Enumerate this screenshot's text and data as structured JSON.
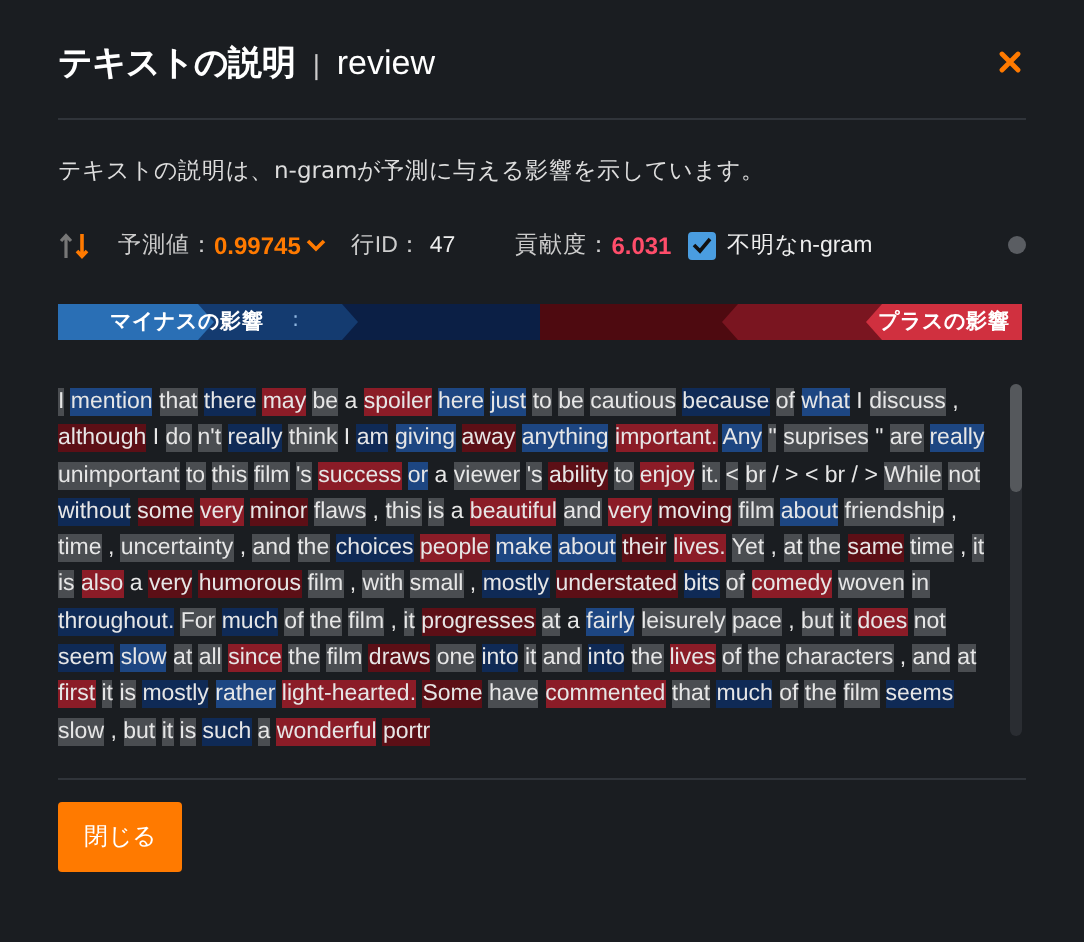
{
  "dialog": {
    "title": "テキストの説明",
    "separator": "|",
    "subtitle": "review",
    "description": "テキストの説明は、n-gramが予測に与える影響を示しています。"
  },
  "stats": {
    "prediction_label": "予測値：",
    "prediction_value": "0.99745",
    "row_label": "行ID：",
    "row_value": "47",
    "contribution_label": "貢献度：",
    "contribution_value": "6.031",
    "unknown_ngram": {
      "label": "不明なn-gram",
      "checked": true
    }
  },
  "legend": {
    "negative_label": "マイナスの影響",
    "separator": ":",
    "positive_label": "プラスの影響"
  },
  "tokens": [
    {
      "text": "I",
      "color": "#4a4d51"
    },
    {
      "text": "mention",
      "color": "#1d4682"
    },
    {
      "text": "that",
      "color": "#4a4d51"
    },
    {
      "text": "there",
      "color": "#0f2a56"
    },
    {
      "text": "may",
      "color": "#8b1c27"
    },
    {
      "text": "be",
      "color": "#4a4d51"
    },
    {
      "text": "a"
    },
    {
      "text": "spoiler",
      "color": "#8b1c27"
    },
    {
      "text": "here",
      "color": "#1d4682"
    },
    {
      "text": "just",
      "color": "#1d4682"
    },
    {
      "text": "to",
      "color": "#4a4d51"
    },
    {
      "text": "be",
      "color": "#4a4d51"
    },
    {
      "text": "cautious",
      "color": "#4a4d51"
    },
    {
      "text": "because",
      "color": "#0f2a56"
    },
    {
      "text": "of",
      "color": "#4a4d51"
    },
    {
      "text": "what",
      "color": "#1d4682"
    },
    {
      "text": "I"
    },
    {
      "text": "discuss",
      "color": "#4a4d51"
    },
    {
      "text": ","
    },
    {
      "text": "although",
      "color": "#5c0f16"
    },
    {
      "text": "I"
    },
    {
      "text": "do",
      "color": "#4a4d51"
    },
    {
      "text": "n't",
      "color": "#4a4d51"
    },
    {
      "text": "really",
      "color": "#0f2a56"
    },
    {
      "text": "think",
      "color": "#4a4d51"
    },
    {
      "text": "I"
    },
    {
      "text": "am",
      "color": "#0f2a56"
    },
    {
      "text": "giving",
      "color": "#1d4682"
    },
    {
      "text": "away",
      "color": "#5c0f16"
    },
    {
      "text": "anything",
      "color": "#1d4682"
    },
    {
      "text": "important.",
      "color": "#8b1c27"
    },
    {
      "text": "Any",
      "color": "#1d4682"
    },
    {
      "text": "\"",
      "color": "#4a4d51"
    },
    {
      "text": "suprises",
      "color": "#4a4d51"
    },
    {
      "text": "\""
    },
    {
      "text": "are",
      "color": "#4a4d51"
    },
    {
      "text": "really",
      "color": "#1d4682"
    },
    {
      "text": "unimportant",
      "color": "#4a4d51"
    },
    {
      "text": "to",
      "color": "#4a4d51"
    },
    {
      "text": "this",
      "color": "#4a4d51"
    },
    {
      "text": "film",
      "color": "#4a4d51"
    },
    {
      "text": "'s",
      "color": "#4a4d51"
    },
    {
      "text": "success",
      "color": "#8b1c27"
    },
    {
      "text": "or",
      "color": "#1d4682"
    },
    {
      "text": "a"
    },
    {
      "text": "viewer",
      "color": "#4a4d51"
    },
    {
      "text": "'s",
      "color": "#4a4d51"
    },
    {
      "text": "ability",
      "color": "#5c0f16"
    },
    {
      "text": "to",
      "color": "#4a4d51"
    },
    {
      "text": "enjoy",
      "color": "#8b1c27"
    },
    {
      "text": "it.",
      "color": "#4a4d51"
    },
    {
      "text": "<",
      "color": "#4a4d51"
    },
    {
      "text": "br",
      "color": "#4a4d51"
    },
    {
      "text": "/"
    },
    {
      "text": ">"
    },
    {
      "text": "<"
    },
    {
      "text": "br"
    },
    {
      "text": "/"
    },
    {
      "text": ">"
    },
    {
      "text": "While",
      "color": "#4a4d51"
    },
    {
      "text": "not",
      "color": "#4a4d51"
    },
    {
      "text": "without",
      "color": "#0f2a56"
    },
    {
      "text": "some",
      "color": "#5c0f16"
    },
    {
      "text": "very",
      "color": "#8b1c27"
    },
    {
      "text": "minor",
      "color": "#5c0f16"
    },
    {
      "text": "flaws",
      "color": "#4a4d51"
    },
    {
      "text": ","
    },
    {
      "text": "this",
      "color": "#4a4d51"
    },
    {
      "text": "is",
      "color": "#4a4d51"
    },
    {
      "text": "a"
    },
    {
      "text": "beautiful",
      "color": "#8b1c27"
    },
    {
      "text": "and",
      "color": "#4a4d51"
    },
    {
      "text": "very",
      "color": "#8b1c27"
    },
    {
      "text": "moving",
      "color": "#5c0f16"
    },
    {
      "text": "film",
      "color": "#4a4d51"
    },
    {
      "text": "about",
      "color": "#1d4682"
    },
    {
      "text": "friendship",
      "color": "#4a4d51"
    },
    {
      "text": ","
    },
    {
      "text": "time",
      "color": "#4a4d51"
    },
    {
      "text": ","
    },
    {
      "text": "uncertainty",
      "color": "#4a4d51"
    },
    {
      "text": ","
    },
    {
      "text": "and",
      "color": "#4a4d51"
    },
    {
      "text": "the",
      "color": "#4a4d51"
    },
    {
      "text": "choices",
      "color": "#0f2a56"
    },
    {
      "text": "people",
      "color": "#8b1c27"
    },
    {
      "text": "make",
      "color": "#1d4682"
    },
    {
      "text": "about",
      "color": "#1d4682"
    },
    {
      "text": "their",
      "color": "#5c0f16"
    },
    {
      "text": "lives.",
      "color": "#8b1c27"
    },
    {
      "text": "Yet",
      "color": "#4a4d51"
    },
    {
      "text": ","
    },
    {
      "text": "at",
      "color": "#4a4d51"
    },
    {
      "text": "the",
      "color": "#4a4d51"
    },
    {
      "text": "same",
      "color": "#5c0f16"
    },
    {
      "text": "time",
      "color": "#4a4d51"
    },
    {
      "text": ","
    },
    {
      "text": "it",
      "color": "#4a4d51"
    },
    {
      "text": "is",
      "color": "#4a4d51"
    },
    {
      "text": "also",
      "color": "#8b1c27"
    },
    {
      "text": "a"
    },
    {
      "text": "very",
      "color": "#5c0f16"
    },
    {
      "text": "humorous",
      "color": "#5c0f16"
    },
    {
      "text": "film",
      "color": "#4a4d51"
    },
    {
      "text": ","
    },
    {
      "text": "with",
      "color": "#4a4d51"
    },
    {
      "text": "small",
      "color": "#4a4d51"
    },
    {
      "text": ","
    },
    {
      "text": "mostly",
      "color": "#0f2a56"
    },
    {
      "text": "understated",
      "color": "#5c0f16"
    },
    {
      "text": "bits",
      "color": "#0f2a56"
    },
    {
      "text": "of",
      "color": "#4a4d51"
    },
    {
      "text": "comedy",
      "color": "#8b1c27"
    },
    {
      "text": "woven",
      "color": "#4a4d51"
    },
    {
      "text": "in",
      "color": "#4a4d51"
    },
    {
      "text": "throughout.",
      "color": "#0f2a56"
    },
    {
      "text": "For",
      "color": "#4a4d51"
    },
    {
      "text": "much",
      "color": "#0f2a56"
    },
    {
      "text": "of",
      "color": "#4a4d51"
    },
    {
      "text": "the",
      "color": "#4a4d51"
    },
    {
      "text": "film",
      "color": "#4a4d51"
    },
    {
      "text": ","
    },
    {
      "text": "it",
      "color": "#4a4d51"
    },
    {
      "text": "progresses",
      "color": "#5c0f16"
    },
    {
      "text": "at",
      "color": "#4a4d51"
    },
    {
      "text": "a"
    },
    {
      "text": "fairly",
      "color": "#1d4682"
    },
    {
      "text": "leisurely",
      "color": "#4a4d51"
    },
    {
      "text": "pace",
      "color": "#4a4d51"
    },
    {
      "text": ","
    },
    {
      "text": "but",
      "color": "#4a4d51"
    },
    {
      "text": "it",
      "color": "#4a4d51"
    },
    {
      "text": "does",
      "color": "#8b1c27"
    },
    {
      "text": "not",
      "color": "#4a4d51"
    },
    {
      "text": "seem",
      "color": "#0f2a56"
    },
    {
      "text": "slow",
      "color": "#1d4682"
    },
    {
      "text": "at",
      "color": "#4a4d51"
    },
    {
      "text": "all",
      "color": "#4a4d51"
    },
    {
      "text": "since",
      "color": "#8b1c27"
    },
    {
      "text": "the",
      "color": "#4a4d51"
    },
    {
      "text": "film",
      "color": "#4a4d51"
    },
    {
      "text": "draws",
      "color": "#5c0f16"
    },
    {
      "text": "one",
      "color": "#4a4d51"
    },
    {
      "text": "into",
      "color": "#0f2a56"
    },
    {
      "text": "it",
      "color": "#4a4d51"
    },
    {
      "text": "and",
      "color": "#4a4d51"
    },
    {
      "text": "into",
      "color": "#0f2a56"
    },
    {
      "text": "the",
      "color": "#4a4d51"
    },
    {
      "text": "lives",
      "color": "#8b1c27"
    },
    {
      "text": "of",
      "color": "#4a4d51"
    },
    {
      "text": "the",
      "color": "#4a4d51"
    },
    {
      "text": "characters",
      "color": "#4a4d51"
    },
    {
      "text": ","
    },
    {
      "text": "and",
      "color": "#4a4d51"
    },
    {
      "text": "at",
      "color": "#4a4d51"
    },
    {
      "text": "first",
      "color": "#8b1c27"
    },
    {
      "text": "it",
      "color": "#4a4d51"
    },
    {
      "text": "is",
      "color": "#4a4d51"
    },
    {
      "text": "mostly",
      "color": "#0f2a56"
    },
    {
      "text": "rather",
      "color": "#1d4682"
    },
    {
      "text": "light-hearted.",
      "color": "#8b1c27"
    },
    {
      "text": "Some",
      "color": "#5c0f16"
    },
    {
      "text": "have",
      "color": "#4a4d51"
    },
    {
      "text": "commented",
      "color": "#8b1c27"
    },
    {
      "text": "that",
      "color": "#4a4d51"
    },
    {
      "text": "much",
      "color": "#0f2a56"
    },
    {
      "text": "of",
      "color": "#4a4d51"
    },
    {
      "text": "the",
      "color": "#4a4d51"
    },
    {
      "text": "film",
      "color": "#4a4d51"
    },
    {
      "text": "seems",
      "color": "#0f2a56"
    },
    {
      "text": "slow",
      "color": "#4a4d51"
    },
    {
      "text": ","
    },
    {
      "text": "but",
      "color": "#4a4d51"
    },
    {
      "text": "it",
      "color": "#4a4d51"
    },
    {
      "text": "is",
      "color": "#4a4d51"
    },
    {
      "text": "such",
      "color": "#0f2a56"
    },
    {
      "text": "a",
      "color": "#4a4d51"
    },
    {
      "text": "wonderful",
      "color": "#8b1c27"
    },
    {
      "text": "portr",
      "color": "#5c0f16"
    }
  ],
  "buttons": [
    {
      "label": "閉じる"
    }
  ]
}
